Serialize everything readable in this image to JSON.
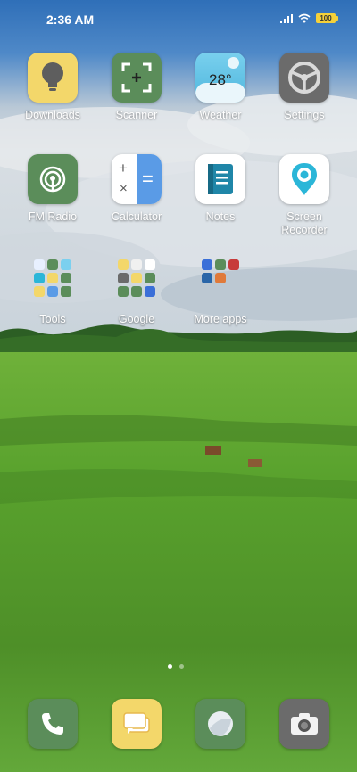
{
  "status_bar": {
    "time": "2:36 AM",
    "battery_level": "100",
    "icons": [
      "signal-icon",
      "wifi-icon",
      "battery-icon"
    ]
  },
  "apps": [
    {
      "label": "Downloads",
      "icon": "lightbulb-icon",
      "color": "#f3d76a"
    },
    {
      "label": "Scanner",
      "icon": "scan-icon",
      "color": "#5b8d5a"
    },
    {
      "label": "Weather",
      "icon": "weather-icon",
      "color": "#6cc6e8",
      "temperature": "28°"
    },
    {
      "label": "Settings",
      "icon": "gear-icon",
      "color": "#6b6b6b"
    },
    {
      "label": "FM Radio",
      "icon": "radio-icon",
      "color": "#5b8d5a"
    },
    {
      "label": "Calculator",
      "icon": "calculator-icon",
      "color": "#ffffff"
    },
    {
      "label": "Notes",
      "icon": "notes-icon",
      "color": "#ffffff"
    },
    {
      "label": "Screen\nRecorder",
      "icon": "screen-recorder-icon",
      "color": "#ffffff"
    }
  ],
  "folders": [
    {
      "label": "Tools"
    },
    {
      "label": "Google"
    },
    {
      "label": "More apps"
    }
  ],
  "dock": [
    {
      "name": "phone",
      "icon": "phone-icon",
      "color": "#5b8d5a"
    },
    {
      "name": "messages",
      "icon": "messages-icon",
      "color": "#f3d76a"
    },
    {
      "name": "browser",
      "icon": "browser-icon",
      "color": "#5b8d5a"
    },
    {
      "name": "camera",
      "icon": "camera-icon",
      "color": "#6b6b6b"
    }
  ],
  "page_indicator": {
    "pages": 2,
    "current": 1
  }
}
